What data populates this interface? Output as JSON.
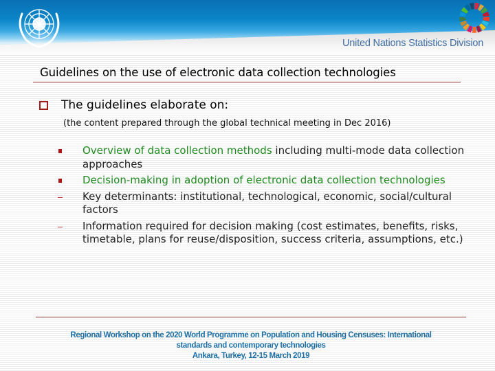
{
  "header": {
    "logo": "un-emblem-icon",
    "sdg_logo": "sdg-wheel-icon",
    "organization": "United Nations Statistics Division",
    "colors": {
      "blue": "#0b86c9",
      "org_text": "#3f6ea4"
    }
  },
  "slide": {
    "title": "Guidelines on the use of electronic data collection technologies",
    "main_point": {
      "bullet_icon": "hollow-square-bullet-icon",
      "text": "The guidelines elaborate on:"
    },
    "note": "(the content prepared through the global technical meeting in Dec 2016)",
    "items": [
      {
        "bullet": "square",
        "highlight": "Overview of data collection methods",
        "rest": " including multi-mode data collection approaches"
      },
      {
        "bullet": "square",
        "highlight": "Decision-making in adoption of electronic data collection technologies",
        "rest": ""
      },
      {
        "bullet": "dash",
        "highlight": "",
        "rest": "Key determinants: institutional, technological, economic, social/cultural factors"
      },
      {
        "bullet": "dash",
        "highlight": "",
        "rest": "Information required for decision making (cost estimates, benefits, risks, timetable, plans for reuse/disposition, success criteria, assumptions, etc.)"
      }
    ],
    "colors": {
      "accent_red": "#a01a1a",
      "highlight_green": "#1f8a1f"
    }
  },
  "footer": {
    "line1": "Regional Workshop on the 2020 World Programme on Population and Housing Censuses: International",
    "line2": "standards and contemporary technologies",
    "line3": "Ankara, Turkey, 12-15 March 2019",
    "color": "#1e6fa5"
  }
}
